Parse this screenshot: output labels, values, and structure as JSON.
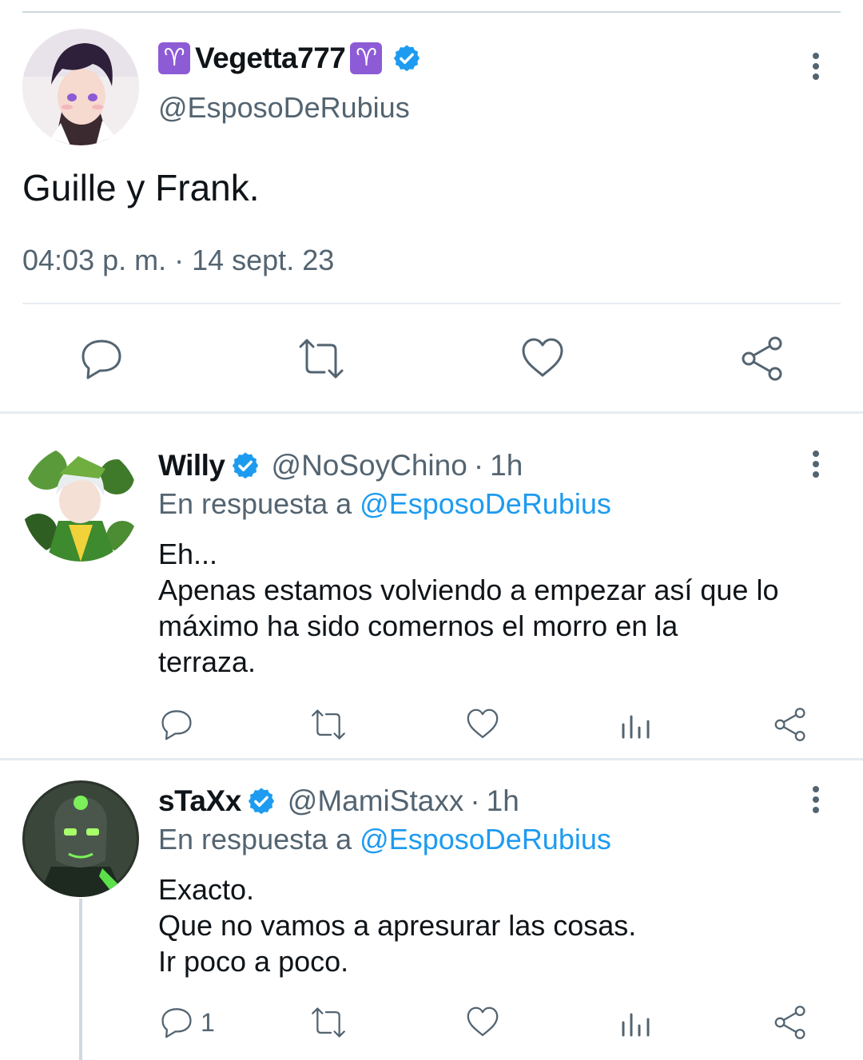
{
  "main_tweet": {
    "zodiac_left": "♈",
    "display_name": "Vegetta777",
    "zodiac_right": "♈",
    "handle": "@EsposoDeRubius",
    "text": "Guille y Frank.",
    "timestamp": "04:03 p. m. · 14 sept. 23",
    "actions": [
      "reply-icon",
      "retweet-icon",
      "like-icon",
      "share-icon"
    ]
  },
  "replies": [
    {
      "display_name": "Willy",
      "handle": "@NoSoyChino",
      "separator": "·",
      "time": "1h",
      "reply_prefix": "En respuesta a ",
      "reply_to": "@EsposoDeRubius",
      "lines": [
        "Eh...",
        "Apenas estamos volviendo a empezar así que lo",
        "máximo ha sido comernos el morro en la",
        "terraza."
      ],
      "reply_count": ""
    },
    {
      "display_name": "sTaXx",
      "handle": "@MamiStaxx",
      "separator": "·",
      "time": "1h",
      "reply_prefix": "En respuesta a ",
      "reply_to": "@EsposoDeRubius",
      "lines": [
        "Exacto.",
        "Que no vamos a apresurar las cosas.",
        "Ir poco a poco."
      ],
      "reply_count": "1"
    }
  ],
  "colors": {
    "text": "#0f1419",
    "secondary": "#536471",
    "link": "#1d9bf0",
    "verified": "#1d9bf0",
    "zodiac": "#8e5bd6"
  }
}
